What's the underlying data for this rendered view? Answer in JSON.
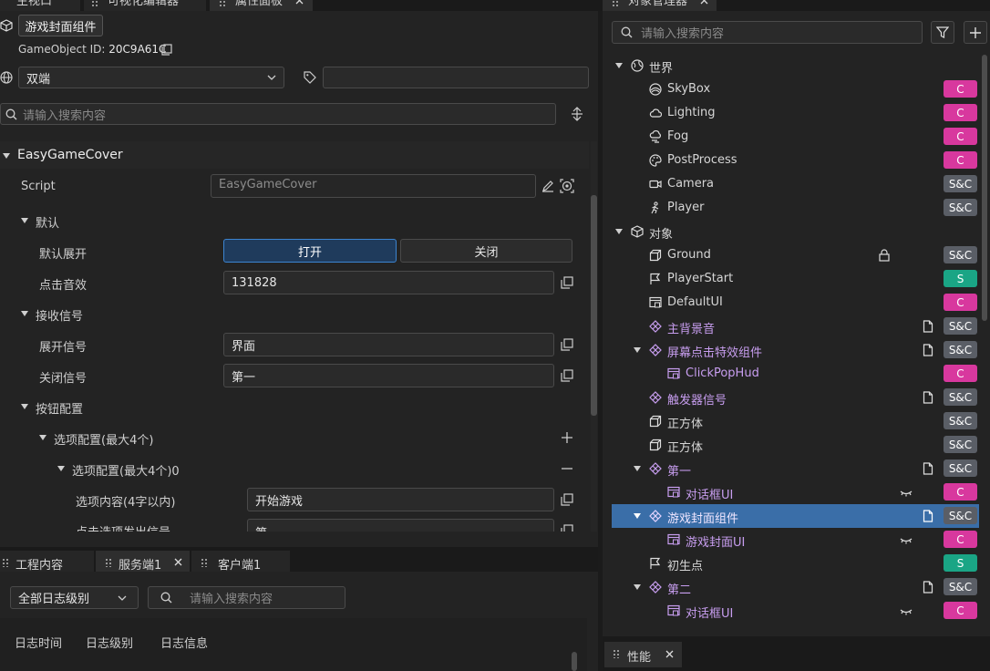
{
  "top_tabs": [
    {
      "label": "主视口"
    },
    {
      "label": "可视化编辑器"
    },
    {
      "label": "属性面板"
    },
    {
      "label": "对象管理器"
    }
  ],
  "inspector": {
    "component_name": "游戏封面组件",
    "gameobject_id_label": "GameObject ID:",
    "gameobject_id": "20C9A61C",
    "network_select": "双端",
    "tag_input": "",
    "search_placeholder": "请输入搜索内容",
    "section_title": "EasyGameCover",
    "script_label": "Script",
    "script_value": "EasyGameCover",
    "group_default": "默认",
    "default_expand_label": "默认展开",
    "open_label": "打开",
    "close_label": "关闭",
    "click_sound_label": "点击音效",
    "click_sound_value": "131828",
    "group_receive": "接收信号",
    "expand_signal_label": "展开信号",
    "expand_signal_value": "界面",
    "close_signal_label": "关闭信号",
    "close_signal_value": "第一",
    "group_button": "按钮配置",
    "options_group": "选项配置(最大4个)",
    "options_item": "选项配置(最大4个)0",
    "option_content_label": "选项内容(4字以内)",
    "option_content_value": "开始游戏",
    "option_signal_label": "点击选项发出信号",
    "option_signal_value": "第一"
  },
  "bottom": {
    "tabs": [
      {
        "label": "工程内容"
      },
      {
        "label": "服务端1"
      },
      {
        "label": "客户端1"
      }
    ],
    "log_level": "全部日志级别",
    "search_placeholder": "请输入搜索内容",
    "columns": [
      "日志时间",
      "日志级别",
      "日志信息"
    ]
  },
  "object_manager": {
    "search_placeholder": "请输入搜索内容",
    "rows": [
      {
        "name": "世界",
        "badge": "",
        "icon": "world-icon"
      },
      {
        "name": "SkyBox",
        "badge": "C",
        "icon": "skybox-icon"
      },
      {
        "name": "Lighting",
        "badge": "C",
        "icon": "cloud-icon"
      },
      {
        "name": "Fog",
        "badge": "C",
        "icon": "fog-icon"
      },
      {
        "name": "PostProcess",
        "badge": "C",
        "icon": "palette-icon"
      },
      {
        "name": "Camera",
        "badge": "S&C",
        "icon": "camera-icon"
      },
      {
        "name": "Player",
        "badge": "S&C",
        "icon": "player-icon"
      },
      {
        "name": "对象",
        "badge": "",
        "icon": "cube-icon"
      },
      {
        "name": "Ground",
        "badge": "S&C",
        "icon": "box-icon"
      },
      {
        "name": "PlayerStart",
        "badge": "S",
        "icon": "flag-icon"
      },
      {
        "name": "DefaultUI",
        "badge": "C",
        "icon": "ui-icon"
      },
      {
        "name": "主背景音",
        "badge": "S&C",
        "icon": "prefab-icon"
      },
      {
        "name": "屏幕点击特效组件",
        "badge": "S&C",
        "icon": "prefab-icon"
      },
      {
        "name": "ClickPopHud",
        "badge": "C",
        "icon": "ui-icon"
      },
      {
        "name": "触发器信号",
        "badge": "S&C",
        "icon": "prefab-icon"
      },
      {
        "name": "正方体",
        "badge": "S&C",
        "icon": "box-icon"
      },
      {
        "name": "正方体",
        "badge": "S&C",
        "icon": "box-icon"
      },
      {
        "name": "第一",
        "badge": "S&C",
        "icon": "prefab-icon"
      },
      {
        "name": "对话框UI",
        "badge": "C",
        "icon": "ui-icon"
      },
      {
        "name": "游戏封面组件",
        "badge": "S&C",
        "icon": "prefab-icon"
      },
      {
        "name": "游戏封面UI",
        "badge": "C",
        "icon": "ui-icon"
      },
      {
        "name": "初生点",
        "badge": "S",
        "icon": "flag-icon"
      },
      {
        "name": "第二",
        "badge": "S&C",
        "icon": "prefab-icon"
      },
      {
        "name": "对话框UI",
        "badge": "C",
        "icon": "ui-icon"
      }
    ]
  },
  "perf_tab": {
    "label": "性能"
  },
  "colors": {
    "accent": "#3a6ea8",
    "badge_c": "#d8389e",
    "badge_sc": "#5a5e66",
    "badge_s": "#1aa585",
    "prefab_text": "#c89ef0"
  }
}
